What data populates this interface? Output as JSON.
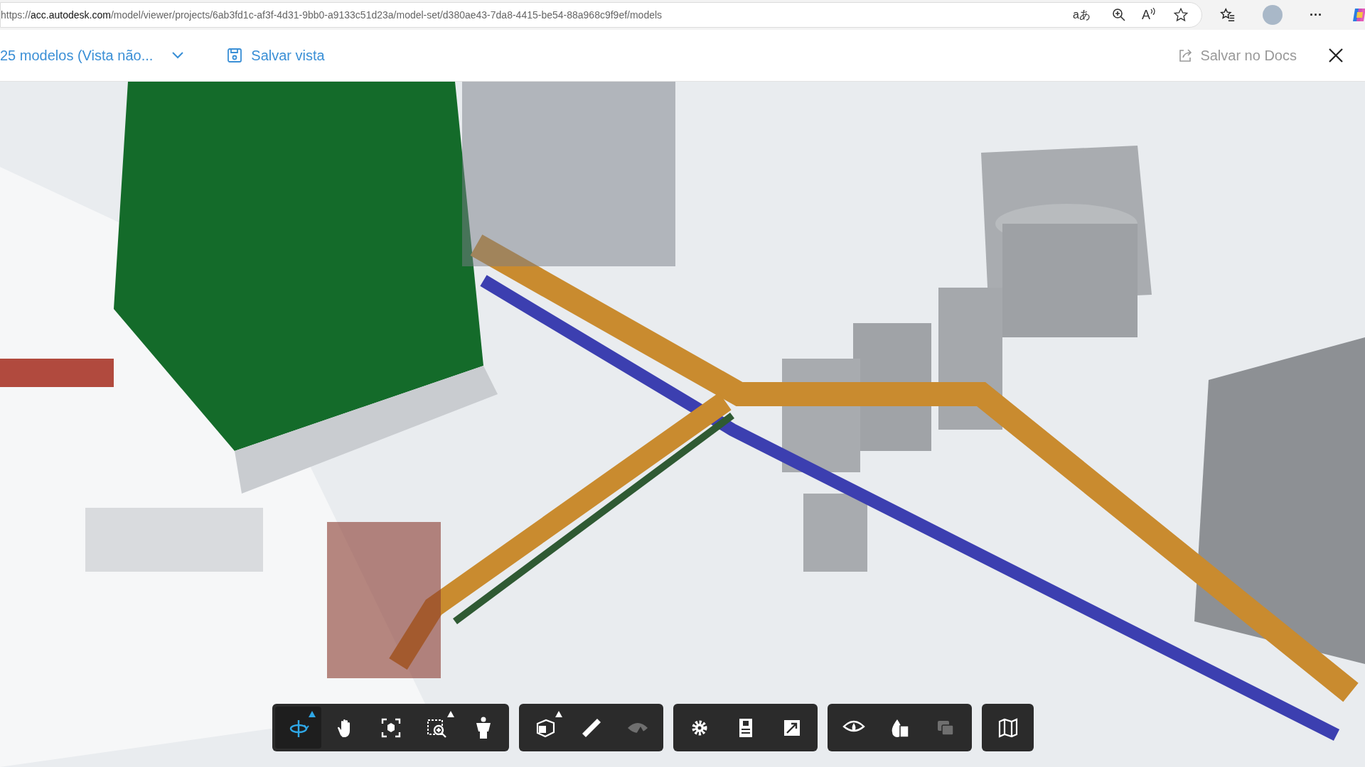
{
  "browser": {
    "address": {
      "scheme": "https://",
      "host": "acc.autodesk.com",
      "path": "/model/viewer/projects/6ab3fd1c-af3f-4d31-9bb0-a9133c51d23a/model-set/d380ae43-7da8-4415-be54-88a968c9f9ef/models"
    },
    "translate_glyph": "aあ",
    "read_aloud_glyph": "A",
    "more_glyph": "···"
  },
  "header": {
    "model_selector": "25 modelos (Vista não...",
    "save_view": "Salvar vista",
    "save_to_docs": "Salvar no Docs"
  },
  "toolbar": [
    [
      {
        "kind": "orbit",
        "selected": true,
        "disabled": false,
        "flyout": true
      },
      {
        "kind": "pan",
        "selected": false,
        "disabled": false,
        "flyout": false
      },
      {
        "kind": "fit",
        "selected": false,
        "disabled": false,
        "flyout": false
      },
      {
        "kind": "zoom-window",
        "selected": false,
        "disabled": false,
        "flyout": true
      },
      {
        "kind": "walk",
        "selected": false,
        "disabled": false,
        "flyout": false
      }
    ],
    [
      {
        "kind": "section",
        "selected": false,
        "disabled": false,
        "flyout": true
      },
      {
        "kind": "measure",
        "selected": false,
        "disabled": false,
        "flyout": false
      },
      {
        "kind": "ghost",
        "selected": false,
        "disabled": true,
        "flyout": false
      }
    ],
    [
      {
        "kind": "settings",
        "selected": false,
        "disabled": false,
        "flyout": false
      },
      {
        "kind": "properties",
        "selected": false,
        "disabled": false,
        "flyout": false
      },
      {
        "kind": "fullscreen",
        "selected": false,
        "disabled": false,
        "flyout": false
      }
    ],
    [
      {
        "kind": "visibility",
        "selected": false,
        "disabled": false,
        "flyout": false
      },
      {
        "kind": "data",
        "selected": false,
        "disabled": false,
        "flyout": false
      },
      {
        "kind": "overlay",
        "selected": false,
        "disabled": true,
        "flyout": false
      }
    ],
    [
      {
        "kind": "map",
        "selected": false,
        "disabled": false,
        "flyout": false
      }
    ]
  ]
}
